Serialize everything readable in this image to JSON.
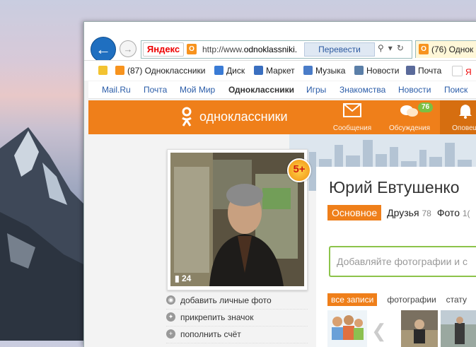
{
  "browser": {
    "search_engine": "Яндекс",
    "url_prefix": "http://www.",
    "url_domain": "odnoklassniki.",
    "translate_label": "Перевести",
    "tab_title": "(76) Однок"
  },
  "favorites": [
    {
      "label": "(87) Одноклассники",
      "color": "#f7931e"
    },
    {
      "label": "Диск",
      "color": "#3a7bd5"
    },
    {
      "label": "Маркет",
      "color": "#3a6fc0"
    },
    {
      "label": "Музыка",
      "color": "#4a7cc8"
    },
    {
      "label": "Новости",
      "color": "#5b7fa8"
    },
    {
      "label": "Почта",
      "color": "#5a6a9a"
    },
    {
      "label": "Я",
      "color": "#e00000"
    }
  ],
  "ok_topnav": [
    "Mail.Ru",
    "Почта",
    "Мой Мир",
    "Одноклассники",
    "Игры",
    "Знакомства",
    "Новости",
    "Поиск"
  ],
  "ok_header": {
    "logo": "одноклассники",
    "items": [
      {
        "label": "Сообщения",
        "icon": "envelope-icon"
      },
      {
        "label": "Обсуждения",
        "icon": "chat-bubbles-icon",
        "badge": "76"
      },
      {
        "label": "Оповещ",
        "icon": "bell-icon"
      }
    ]
  },
  "profile": {
    "comment_count": "24",
    "badge": "5+",
    "name": "Юрий Евтушенко",
    "tabs": [
      {
        "label": "Основное"
      },
      {
        "label": "Друзья",
        "count": "78"
      },
      {
        "label": "Фото",
        "count": "1("
      }
    ],
    "post_placeholder": "Добавляйте фотографии и с",
    "feed_tabs": [
      "все записи",
      "фотографии",
      "стату"
    ]
  },
  "side_links": [
    "добавить личные фото",
    "прикрепить значок",
    "пополнить счёт"
  ],
  "colors": {
    "ok_orange": "#ef7f1a",
    "link_blue": "#2a5ca8",
    "green": "#8cc34a"
  }
}
